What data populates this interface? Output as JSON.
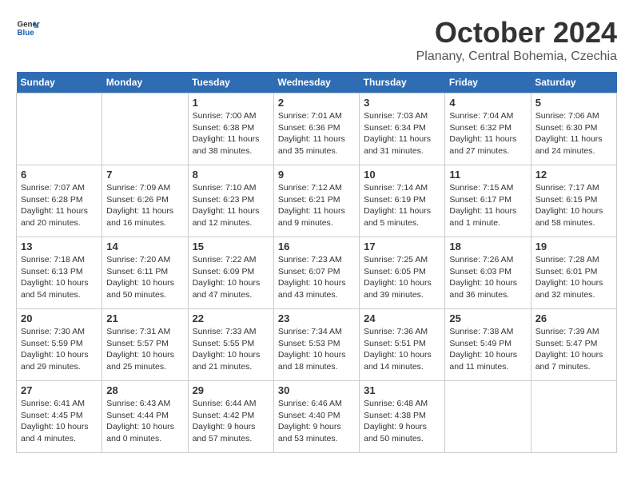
{
  "header": {
    "logo": {
      "general": "General",
      "blue": "Blue"
    },
    "title": "October 2024",
    "location": "Planany, Central Bohemia, Czechia"
  },
  "calendar": {
    "days_of_week": [
      "Sunday",
      "Monday",
      "Tuesday",
      "Wednesday",
      "Thursday",
      "Friday",
      "Saturday"
    ],
    "weeks": [
      [
        {
          "day": "",
          "info": ""
        },
        {
          "day": "",
          "info": ""
        },
        {
          "day": "1",
          "info": "Sunrise: 7:00 AM\nSunset: 6:38 PM\nDaylight: 11 hours and 38 minutes."
        },
        {
          "day": "2",
          "info": "Sunrise: 7:01 AM\nSunset: 6:36 PM\nDaylight: 11 hours and 35 minutes."
        },
        {
          "day": "3",
          "info": "Sunrise: 7:03 AM\nSunset: 6:34 PM\nDaylight: 11 hours and 31 minutes."
        },
        {
          "day": "4",
          "info": "Sunrise: 7:04 AM\nSunset: 6:32 PM\nDaylight: 11 hours and 27 minutes."
        },
        {
          "day": "5",
          "info": "Sunrise: 7:06 AM\nSunset: 6:30 PM\nDaylight: 11 hours and 24 minutes."
        }
      ],
      [
        {
          "day": "6",
          "info": "Sunrise: 7:07 AM\nSunset: 6:28 PM\nDaylight: 11 hours and 20 minutes."
        },
        {
          "day": "7",
          "info": "Sunrise: 7:09 AM\nSunset: 6:26 PM\nDaylight: 11 hours and 16 minutes."
        },
        {
          "day": "8",
          "info": "Sunrise: 7:10 AM\nSunset: 6:23 PM\nDaylight: 11 hours and 12 minutes."
        },
        {
          "day": "9",
          "info": "Sunrise: 7:12 AM\nSunset: 6:21 PM\nDaylight: 11 hours and 9 minutes."
        },
        {
          "day": "10",
          "info": "Sunrise: 7:14 AM\nSunset: 6:19 PM\nDaylight: 11 hours and 5 minutes."
        },
        {
          "day": "11",
          "info": "Sunrise: 7:15 AM\nSunset: 6:17 PM\nDaylight: 11 hours and 1 minute."
        },
        {
          "day": "12",
          "info": "Sunrise: 7:17 AM\nSunset: 6:15 PM\nDaylight: 10 hours and 58 minutes."
        }
      ],
      [
        {
          "day": "13",
          "info": "Sunrise: 7:18 AM\nSunset: 6:13 PM\nDaylight: 10 hours and 54 minutes."
        },
        {
          "day": "14",
          "info": "Sunrise: 7:20 AM\nSunset: 6:11 PM\nDaylight: 10 hours and 50 minutes."
        },
        {
          "day": "15",
          "info": "Sunrise: 7:22 AM\nSunset: 6:09 PM\nDaylight: 10 hours and 47 minutes."
        },
        {
          "day": "16",
          "info": "Sunrise: 7:23 AM\nSunset: 6:07 PM\nDaylight: 10 hours and 43 minutes."
        },
        {
          "day": "17",
          "info": "Sunrise: 7:25 AM\nSunset: 6:05 PM\nDaylight: 10 hours and 39 minutes."
        },
        {
          "day": "18",
          "info": "Sunrise: 7:26 AM\nSunset: 6:03 PM\nDaylight: 10 hours and 36 minutes."
        },
        {
          "day": "19",
          "info": "Sunrise: 7:28 AM\nSunset: 6:01 PM\nDaylight: 10 hours and 32 minutes."
        }
      ],
      [
        {
          "day": "20",
          "info": "Sunrise: 7:30 AM\nSunset: 5:59 PM\nDaylight: 10 hours and 29 minutes."
        },
        {
          "day": "21",
          "info": "Sunrise: 7:31 AM\nSunset: 5:57 PM\nDaylight: 10 hours and 25 minutes."
        },
        {
          "day": "22",
          "info": "Sunrise: 7:33 AM\nSunset: 5:55 PM\nDaylight: 10 hours and 21 minutes."
        },
        {
          "day": "23",
          "info": "Sunrise: 7:34 AM\nSunset: 5:53 PM\nDaylight: 10 hours and 18 minutes."
        },
        {
          "day": "24",
          "info": "Sunrise: 7:36 AM\nSunset: 5:51 PM\nDaylight: 10 hours and 14 minutes."
        },
        {
          "day": "25",
          "info": "Sunrise: 7:38 AM\nSunset: 5:49 PM\nDaylight: 10 hours and 11 minutes."
        },
        {
          "day": "26",
          "info": "Sunrise: 7:39 AM\nSunset: 5:47 PM\nDaylight: 10 hours and 7 minutes."
        }
      ],
      [
        {
          "day": "27",
          "info": "Sunrise: 6:41 AM\nSunset: 4:45 PM\nDaylight: 10 hours and 4 minutes."
        },
        {
          "day": "28",
          "info": "Sunrise: 6:43 AM\nSunset: 4:44 PM\nDaylight: 10 hours and 0 minutes."
        },
        {
          "day": "29",
          "info": "Sunrise: 6:44 AM\nSunset: 4:42 PM\nDaylight: 9 hours and 57 minutes."
        },
        {
          "day": "30",
          "info": "Sunrise: 6:46 AM\nSunset: 4:40 PM\nDaylight: 9 hours and 53 minutes."
        },
        {
          "day": "31",
          "info": "Sunrise: 6:48 AM\nSunset: 4:38 PM\nDaylight: 9 hours and 50 minutes."
        },
        {
          "day": "",
          "info": ""
        },
        {
          "day": "",
          "info": ""
        }
      ]
    ]
  }
}
